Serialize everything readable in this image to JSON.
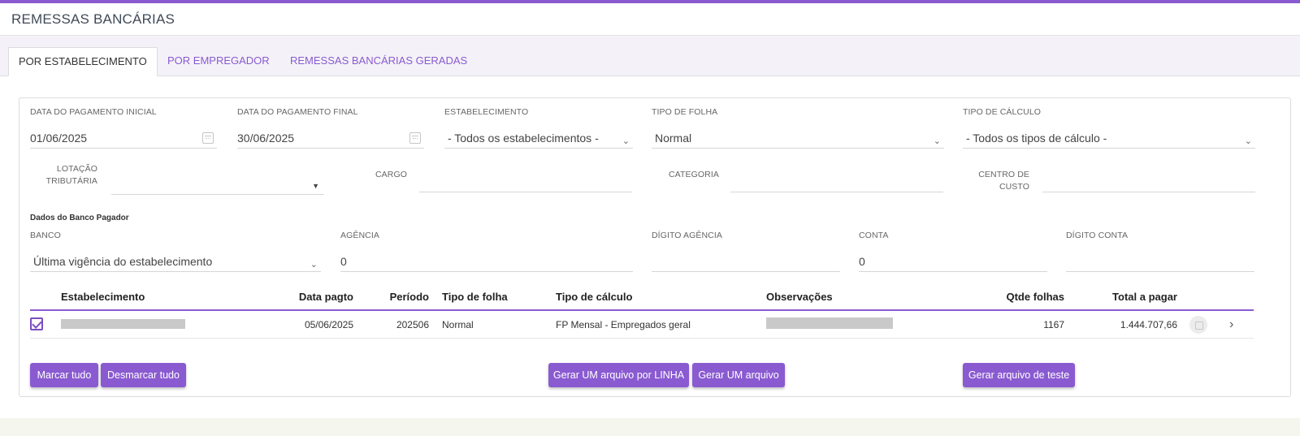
{
  "page": {
    "title": "REMESSAS BANCÁRIAS",
    "accent_color": "#8a5ad1"
  },
  "tabs": [
    {
      "label": "POR ESTABELECIMENTO",
      "active": true
    },
    {
      "label": "POR EMPREGADOR",
      "active": false
    },
    {
      "label": "REMESSAS BANCÁRIAS GERADAS",
      "active": false
    }
  ],
  "filters": {
    "data_inicial": {
      "label": "DATA DO PAGAMENTO INICIAL",
      "value": "01/06/2025",
      "icon": "calendar-icon"
    },
    "data_final": {
      "label": "DATA DO PAGAMENTO FINAL",
      "value": "30/06/2025",
      "icon": "calendar-icon"
    },
    "estabelecimento": {
      "label": "ESTABELECIMENTO",
      "value": "- Todos os estabelecimentos -"
    },
    "tipo_folha": {
      "label": "TIPO DE FOLHA",
      "value": "Normal"
    },
    "tipo_calculo": {
      "label": "TIPO DE CÁLCULO",
      "value": "- Todos os tipos de cálculo -"
    },
    "lotacao": {
      "label_line1": "LOTAÇÃO",
      "label_line2": "TRIBUTÁRIA",
      "value": ""
    },
    "cargo": {
      "label": "CARGO",
      "value": ""
    },
    "categoria": {
      "label": "CATEGORIA",
      "value": ""
    },
    "centro_custo": {
      "label_line1": "CENTRO DE",
      "label_line2": "CUSTO",
      "value": ""
    }
  },
  "banco_pagador": {
    "section_title": "Dados do Banco Pagador",
    "banco": {
      "label": "BANCO",
      "value": "Última vigência do estabelecimento"
    },
    "agencia": {
      "label": "AGÊNCIA",
      "value": "0"
    },
    "digito_agencia": {
      "label": "DÍGITO AGÊNCIA",
      "value": ""
    },
    "conta": {
      "label": "CONTA",
      "value": "0"
    },
    "digito_conta": {
      "label": "DÍGITO CONTA",
      "value": ""
    }
  },
  "table": {
    "headers": {
      "estabelecimento": "Estabelecimento",
      "data_pagto": "Data pagto",
      "periodo": "Período",
      "tipo_folha": "Tipo de folha",
      "tipo_calculo": "Tipo de cálculo",
      "observacoes": "Observações",
      "qtde_folhas": "Qtde folhas",
      "total_pagar": "Total a pagar"
    },
    "rows": [
      {
        "checked": true,
        "data_pagto": "05/06/2025",
        "periodo": "202506",
        "tipo_folha": "Normal",
        "tipo_calculo": "FP Mensal - Empregados geral",
        "qtde_folhas": "1167",
        "total_pagar": "1.444.707,66"
      }
    ]
  },
  "buttons": {
    "marcar_tudo": "Marcar tudo",
    "desmarcar_tudo": "Desmarcar tudo",
    "gerar_por_linha": "Gerar UM arquivo por LINHA",
    "gerar_um": "Gerar UM arquivo",
    "gerar_teste": "Gerar arquivo de teste"
  }
}
